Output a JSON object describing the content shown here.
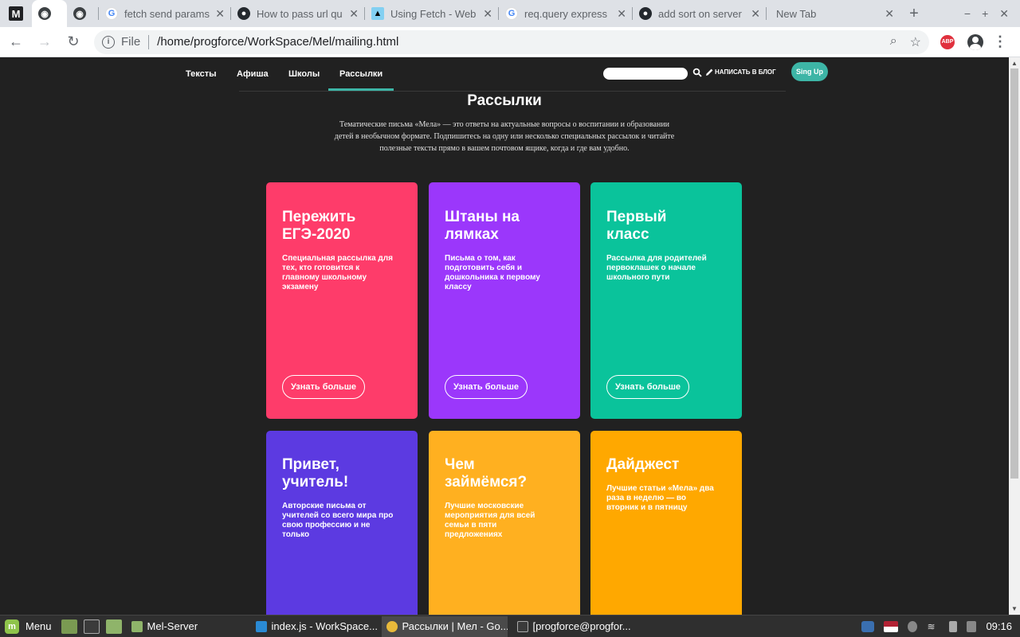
{
  "browser": {
    "tabs": [
      {
        "title": "",
        "icon": "globe-icon",
        "active": true
      },
      {
        "title": "",
        "icon": "globe-icon"
      },
      {
        "title": "fetch send params",
        "icon": "google-icon"
      },
      {
        "title": "How to pass url qu",
        "icon": "github-icon"
      },
      {
        "title": "Using Fetch - Web",
        "icon": "mdn-icon"
      },
      {
        "title": "req.query express",
        "icon": "google-icon"
      },
      {
        "title": "add sort on server",
        "icon": "github-icon"
      },
      {
        "title": "New Tab",
        "icon": "none"
      }
    ],
    "omnibox": {
      "scheme": "File",
      "url": "/home/progforce/WorkSpace/Mel/mailing.html"
    },
    "abp_label": "ABP"
  },
  "site": {
    "nav": [
      "Тексты",
      "Афиша",
      "Школы",
      "Рассылки"
    ],
    "active_nav": "Рассылки",
    "blog_link": "НАПИСАТЬ В БЛОГ",
    "signup": "Sing Up",
    "title": "Рассылки",
    "description": "Тематические письма «Мела» — это ответы на актуальные вопросы о воспитании и образовании детей в необычном формате. Подпишитесь на одну или несколько специальных рассылок и читайте полезные тексты прямо в вашем почтовом ящике, когда и где вам удобно.",
    "accent": "#3db5a6",
    "cards": [
      {
        "title": "Пережить ЕГЭ-2020",
        "desc": "Специальная рассылка для тех, кто готовится к главному школьному экзамену",
        "button": "Узнать больше",
        "color": "#fe3c6a"
      },
      {
        "title": "Штаны на лямках",
        "desc": "Письма о том, как подготовить себя и дошкольника к первому классу",
        "button": "Узнать больше",
        "color": "#9b37fb"
      },
      {
        "title": "Первый класс",
        "desc": "Рассылка для родителей первоклашек о начале школьного пути",
        "button": "Узнать больше",
        "color": "#0ac39b"
      },
      {
        "title": "Привет, учитель!",
        "desc": "Авторские письма от учителей со всего мира про свою профессию и не только",
        "button": "",
        "color": "#5c3ae1"
      },
      {
        "title": "Чем займёмся?",
        "desc": "Лучшие московские мероприятия для всей семьи в пяти предложениях",
        "button": "",
        "color": "#ffb020"
      },
      {
        "title": "Дайджест",
        "desc": "Лучшие статьи «Мела» два раза в неделю — во вторник и в пятницу",
        "button": "",
        "color": "#ffa800"
      }
    ]
  },
  "taskbar": {
    "menu": "Menu",
    "tasks": [
      "Mel-Server",
      "index.js - WorkSpace...",
      "Рассылки | Мел - Go...",
      "[progforce@progfor..."
    ],
    "clock": "09:16"
  }
}
